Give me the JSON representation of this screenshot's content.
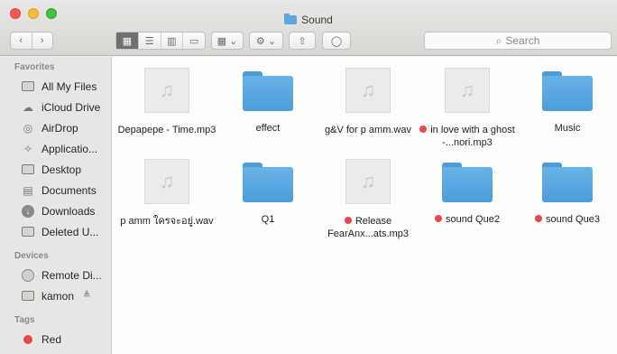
{
  "window": {
    "title": "Sound"
  },
  "toolbar": {
    "back": "‹",
    "forward": "›",
    "views": [
      "▦",
      "☰",
      "▥",
      "▭"
    ],
    "arrange": "▦ ⌄",
    "action": "⚙ ⌄",
    "share": "⇧",
    "tag": "◯",
    "search_placeholder": "Search"
  },
  "sidebar": {
    "favorites_header": "Favorites",
    "favorites": [
      {
        "label": "All My Files",
        "icon": "all-files-icon"
      },
      {
        "label": "iCloud Drive",
        "icon": "cloud-icon"
      },
      {
        "label": "AirDrop",
        "icon": "airdrop-icon"
      },
      {
        "label": "Applicatio...",
        "icon": "applications-icon"
      },
      {
        "label": "Desktop",
        "icon": "desktop-icon"
      },
      {
        "label": "Documents",
        "icon": "documents-icon"
      },
      {
        "label": "Downloads",
        "icon": "downloads-icon"
      },
      {
        "label": "Deleted U...",
        "icon": "folder-icon"
      }
    ],
    "devices_header": "Devices",
    "devices": [
      {
        "label": "Remote Di...",
        "icon": "remote-disc-icon"
      },
      {
        "label": "kamon",
        "icon": "drive-icon",
        "eject": "≜"
      }
    ],
    "tags_header": "Tags",
    "tags": [
      {
        "label": "Red",
        "color": "#e5484d"
      }
    ]
  },
  "files": [
    {
      "name": "Depapepe - Time.mp3",
      "kind": "audio",
      "tagged": false
    },
    {
      "name": "effect",
      "kind": "folder",
      "tagged": false
    },
    {
      "name": "g&V for p amm.wav",
      "kind": "audio",
      "tagged": false
    },
    {
      "name": "in love with a ghost -...nori.mp3",
      "kind": "audio",
      "tagged": true
    },
    {
      "name": "Music",
      "kind": "folder",
      "tagged": false
    },
    {
      "name": "p amm ใครจะอยู่.wav",
      "kind": "audio",
      "tagged": false
    },
    {
      "name": "Q1",
      "kind": "folder",
      "tagged": false
    },
    {
      "name": "Release FearAnx...ats.mp3",
      "kind": "audio",
      "tagged": true
    },
    {
      "name": "sound Que2",
      "kind": "folder",
      "tagged": true
    },
    {
      "name": "sound Que3",
      "kind": "folder",
      "tagged": true
    }
  ],
  "colors": {
    "tag_red": "#e5484d",
    "folder_blue": "#5ea8dd"
  }
}
